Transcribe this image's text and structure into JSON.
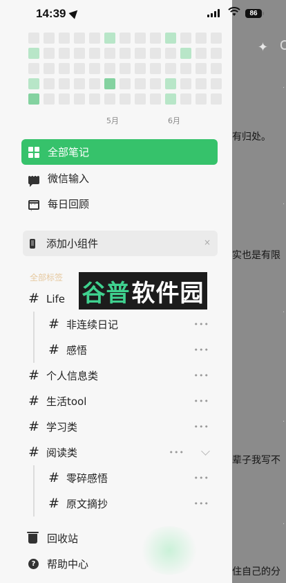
{
  "status_bar": {
    "time": "14:39",
    "battery": "86"
  },
  "activity_grid": {
    "rows": [
      [
        0,
        0,
        0,
        0,
        0,
        1,
        0,
        0,
        0,
        1,
        0,
        0,
        0
      ],
      [
        1,
        0,
        0,
        0,
        0,
        0,
        0,
        0,
        0,
        0,
        1,
        0,
        0
      ],
      [
        0,
        0,
        0,
        0,
        0,
        0,
        0,
        0,
        0,
        0,
        0,
        0,
        0
      ],
      [
        1,
        0,
        0,
        0,
        0,
        2,
        0,
        0,
        0,
        1,
        0,
        0,
        0
      ],
      [
        2,
        0,
        0,
        0,
        0,
        0,
        0,
        0,
        0,
        1,
        0,
        0,
        0
      ]
    ],
    "months": [
      "5月",
      "6月"
    ]
  },
  "nav": {
    "all_notes": "全部笔记",
    "wechat_input": "微信输入",
    "daily_review": "每日回顾"
  },
  "widget_card": {
    "label": "添加小组件",
    "close": "×"
  },
  "tags": {
    "section_title": "全部标签",
    "items": [
      {
        "label": "Life"
      },
      {
        "label": "非连续日记"
      },
      {
        "label": "感悟"
      },
      {
        "label": "个人信息类"
      },
      {
        "label": "生活tool"
      },
      {
        "label": "学习类"
      },
      {
        "label": "阅读类"
      },
      {
        "label": "零碎感悟"
      },
      {
        "label": "原文摘抄"
      }
    ],
    "more_glyph": "•••"
  },
  "bottom": {
    "trash": "回收站",
    "help": "帮助中心"
  },
  "watermark": {
    "part1": "谷普",
    "part2": "软件园"
  },
  "background_snippets": [
    "有归处。",
    "实也是有限",
    "辈子我写不",
    "住自己的分"
  ],
  "colors": {
    "accent": "#36c26b",
    "heat_light": "#b8e6c8",
    "heat_mid": "#84d2a0",
    "section_label": "#e6c9a0"
  }
}
